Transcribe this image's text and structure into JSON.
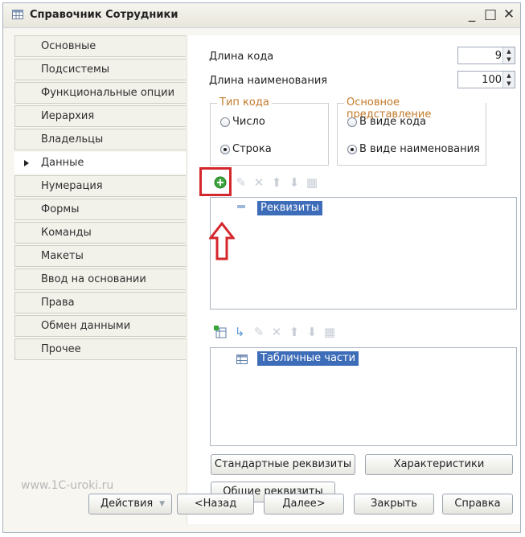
{
  "window": {
    "title": "Справочник Сотрудники",
    "controls": {
      "minimize": "_",
      "maximize": "□",
      "close": "✕"
    }
  },
  "sidebar": {
    "items": [
      {
        "label": "Основные"
      },
      {
        "label": "Подсистемы"
      },
      {
        "label": "Функциональные опции"
      },
      {
        "label": "Иерархия"
      },
      {
        "label": "Владельцы"
      },
      {
        "label": "Данные",
        "selected": true
      },
      {
        "label": "Нумерация"
      },
      {
        "label": "Формы"
      },
      {
        "label": "Команды"
      },
      {
        "label": "Макеты"
      },
      {
        "label": "Ввод на основании"
      },
      {
        "label": "Права"
      },
      {
        "label": "Обмен данными"
      },
      {
        "label": "Прочее"
      }
    ]
  },
  "form": {
    "code_length": {
      "label": "Длина кода",
      "value": "9"
    },
    "name_length": {
      "label": "Длина наименования",
      "value": "100"
    },
    "code_type": {
      "title": "Тип кода",
      "options": [
        {
          "label": "Число",
          "checked": false
        },
        {
          "label": "Строка",
          "checked": true
        }
      ]
    },
    "main_view": {
      "title": "Основное представление",
      "options": [
        {
          "label": "В виде кода",
          "checked": false
        },
        {
          "label": "В виде наименования",
          "checked": true
        }
      ]
    },
    "attributes_tree": {
      "root": "Реквизиты"
    },
    "tabular_tree": {
      "root": "Табличные части"
    }
  },
  "buttons": {
    "standard_attributes": "Стандартные реквизиты",
    "characteristics": "Характеристики",
    "common_attributes": "Общие реквизиты"
  },
  "footer": {
    "actions": "Действия",
    "back": "<Назад",
    "next": "Далее>",
    "close": "Закрыть",
    "help": "Справка"
  },
  "watermark": "www.1C-uroki.ru",
  "colors": {
    "selection": "#3d6cb8",
    "group_title": "#c27a2a",
    "annotation": "#d3272c",
    "add_icon": "#3aa63a"
  }
}
